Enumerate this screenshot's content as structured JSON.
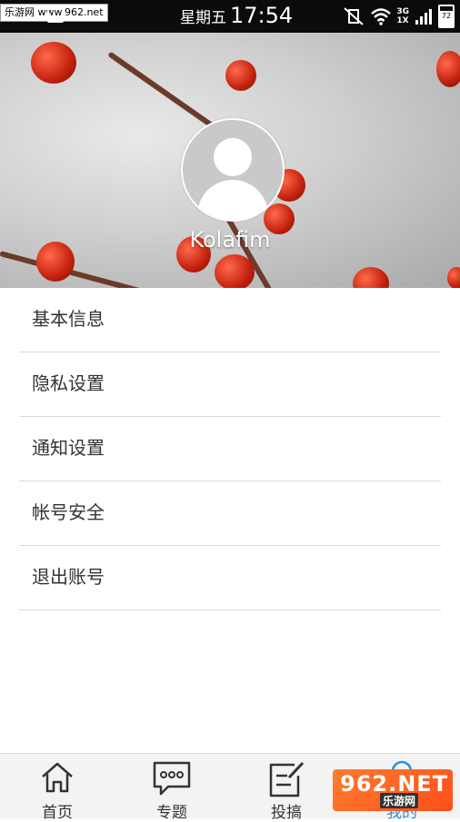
{
  "status_bar": {
    "watermark": "乐游网 www.962.net",
    "weekday": "星期五",
    "time": "17:54",
    "network_top": "3G",
    "network_bottom": "1X",
    "battery": "72"
  },
  "profile": {
    "username": "Kolafim"
  },
  "menu": {
    "items": [
      {
        "label": "基本信息"
      },
      {
        "label": "隐私设置"
      },
      {
        "label": "通知设置"
      },
      {
        "label": "帐号安全"
      },
      {
        "label": "退出账号"
      }
    ]
  },
  "bottom_nav": {
    "items": [
      {
        "label": "首页",
        "icon": "home-icon"
      },
      {
        "label": "专题",
        "icon": "chat-bubble-icon"
      },
      {
        "label": "投搞",
        "icon": "edit-icon"
      },
      {
        "label": "我的",
        "icon": "user-icon"
      }
    ],
    "active_color": "#2b8fdc"
  },
  "watermark_bottom": {
    "big": "962.NET",
    "small": "乐游网"
  }
}
